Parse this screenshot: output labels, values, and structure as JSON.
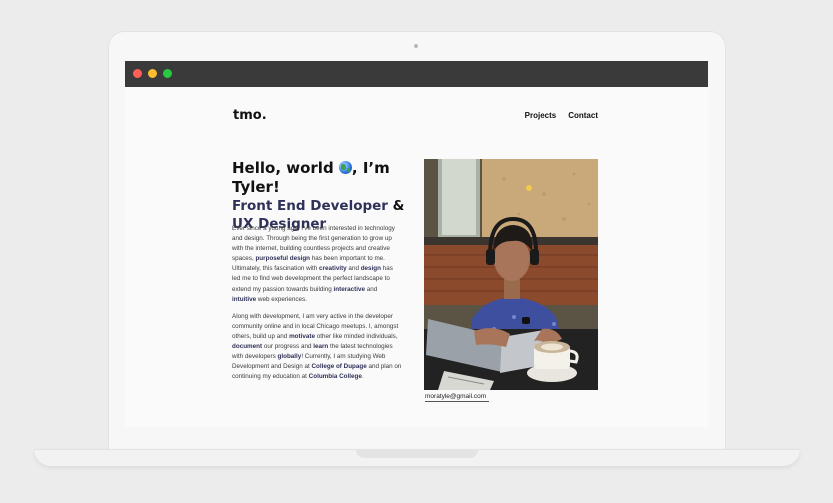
{
  "window": {
    "controls": [
      "close",
      "minimize",
      "maximize"
    ]
  },
  "header": {
    "logo": "tmo.",
    "nav": [
      {
        "label": "Projects"
      },
      {
        "label": "Contact"
      }
    ]
  },
  "hero": {
    "greeting_before": "Hello, world ",
    "greeting_after": ", I’m Tyler!",
    "role_line1": "Front End Developer ",
    "amp": " &",
    "role_line2": "UX Designer"
  },
  "bio": {
    "p1": [
      "Ever since a young age, I've been interested in technology and design. Through being the first generation to grow up with the internet, building countless projects and creative spaces, ",
      "purposeful design",
      " has been important to me. Ultimately, this fascination with ",
      "creativity",
      " and ",
      "design",
      " has led me to find web development the perfect landscape to extend my passion towards building ",
      "interactive",
      " and ",
      "intuitive",
      " web experiences."
    ],
    "p2": [
      "Along with development, I am very active in the developer community online and in local Chicago meetups. I, amongst others, build up and ",
      "motivate",
      " other like minded individuals, ",
      "document",
      " our progress and ",
      "learn",
      " the latest technologies with developers ",
      "globally",
      "! Currently, I am studying Web Development and Design at ",
      "College of Dupage",
      " and plan on continuing my education at ",
      "Columbia College",
      "."
    ]
  },
  "contact": {
    "email": "moratyle@gmail.com"
  },
  "icons": {
    "greeting": "globe-icon"
  },
  "colors": {
    "accent": "#2f3158",
    "titlebar": "#3a3a3a"
  }
}
